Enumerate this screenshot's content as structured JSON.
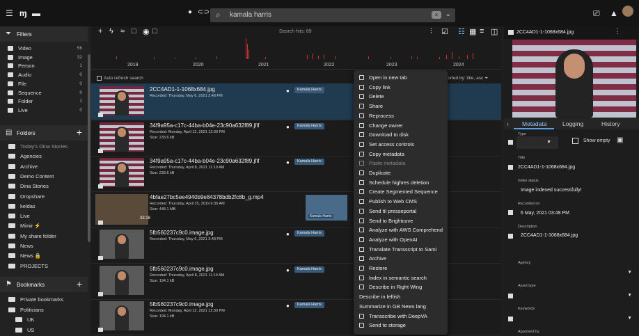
{
  "topbar": {
    "menu_icon": "menu-icon",
    "search_value": "kamala harris",
    "search_icon": "search-icon"
  },
  "sidebar": {
    "filters_title": "Filters",
    "filters": [
      {
        "label": "Video",
        "count": "56"
      },
      {
        "label": "Image",
        "count": "32"
      },
      {
        "label": "Person",
        "count": "1"
      },
      {
        "label": "Audio",
        "count": "0"
      },
      {
        "label": "File",
        "count": "0"
      },
      {
        "label": "Sequence",
        "count": "0"
      },
      {
        "label": "Folder",
        "count": "2"
      },
      {
        "label": "Live",
        "count": "0"
      }
    ],
    "folders_title": "Folders",
    "folders": [
      "Today's Dina Stories",
      "Agencies",
      "Archive",
      "Demo Content",
      "Dina Stories",
      "Dropshare",
      "keldas",
      "Live",
      "Mimir ⚡",
      "My share folder",
      "News",
      "News 🔒",
      "PROJECTS"
    ],
    "bookmarks_title": "Bookmarks",
    "bookmarks": [
      "Private bookmarks",
      "Politicians",
      "UK",
      "US"
    ]
  },
  "main": {
    "search_hits": "Search hits: 89",
    "years": [
      "2019",
      "2020",
      "2021",
      "2022",
      "2023",
      "2024"
    ],
    "auto_refresh": "Auto refresh search",
    "sorted_by": "Sorted by: title, asc",
    "da_label": "Da",
    "results": [
      {
        "name": "2CC4AD1-1-1068x684.jpg",
        "meta": [
          "Recorded: Thursday, May 6, 2021 3:48 PM"
        ],
        "badge": "Kamala Harris"
      },
      {
        "name": "34f9a95a-c17c-44ba-b04e-23c90a632f89.jfif",
        "meta": [
          "Recorded: Monday, April 12, 2021 12:30 PM",
          "Size: 233.6 kB"
        ],
        "badge": "Kamala Harris"
      },
      {
        "name": "34f9a95a-c17c-44ba-b04e-23c90a632f89.jfif",
        "meta": [
          "Recorded: Thursday, April 8, 2021 11:19 AM",
          "Size: 233.6 kB"
        ],
        "badge": "Kamala Harris"
      },
      {
        "name": "4bfae27bc5ee4940b9e84378bdb2fc8b_g.mp4",
        "meta": [
          "Recorded: Thursday, April 25, 2019 6:36 AM",
          "Size: 448.1 MB"
        ],
        "badge": "Kamala Harris",
        "duration": "33:18"
      },
      {
        "name": "5fb560237c9c0.image.jpg",
        "meta": [
          "Recorded: Thursday, May 6, 2021 3:48 PM"
        ],
        "badge": "Kamala Harris"
      },
      {
        "name": "5fb560237c9c0.image.jpg",
        "meta": [
          "Recorded: Thursday, April 8, 2021 11:19 AM",
          "Size: 194.1 kB"
        ],
        "badge": "Kamala Harris"
      },
      {
        "name": "5fb560237c9c0.image.jpg",
        "meta": [
          "Recorded: Monday, April 12, 2021 12:30 PM",
          "Size: 194.1 kB"
        ],
        "badge": "Kamala Harris"
      }
    ]
  },
  "context_menu": [
    {
      "label": "Open in new tab"
    },
    {
      "label": "Copy link"
    },
    {
      "label": "Delete"
    },
    {
      "label": "Share"
    },
    {
      "label": "Reprocess"
    },
    {
      "label": "Change owner"
    },
    {
      "label": "Download to disk"
    },
    {
      "label": "Set access controls"
    },
    {
      "label": "Copy metadata"
    },
    {
      "label": "Paste metadata",
      "disabled": true
    },
    {
      "label": "Duplicate"
    },
    {
      "label": "Schedule highres deletion"
    },
    {
      "label": "Create Segmented Sequence"
    },
    {
      "label": "Publish to Web CMS"
    },
    {
      "label": "Send til presseportal"
    },
    {
      "label": "Send to Brightcove"
    },
    {
      "label": "Analyze with AWS Comprehend"
    },
    {
      "label": "Analyze with OpenAI"
    },
    {
      "label": "Translate Transscript to Sami"
    },
    {
      "label": "Archive"
    },
    {
      "label": "Restore"
    },
    {
      "label": "Index in semantic search"
    },
    {
      "label": "Describe in Right Wing"
    },
    {
      "label": "Describe in leftish",
      "noicon": true
    },
    {
      "label": "Summarize in GB News lang",
      "noicon": true
    },
    {
      "label": "Transscribe with DeepVA"
    },
    {
      "label": "Send to storage"
    }
  ],
  "right_panel": {
    "filename": "2CC4AD1-1-1068x684.jpg",
    "tabs": [
      "Metadata",
      "Logging",
      "History"
    ],
    "type_label": "Type",
    "show_empty": "Show empty",
    "title_label": "Title",
    "title_value": "2CC4AD1-1-1068x684.jpg",
    "index_status_label": "Index status",
    "index_status_value": "Image indexed successfully!",
    "recorded_label": "Recorded on",
    "recorded_value": "6 May, 2021 03:48 PM",
    "description_label": "Description",
    "description_value": "2CC4AD1-1-1068x684.jpg",
    "agency_label": "Agency",
    "asset_type_label": "Asset type",
    "keywords_label": "Keywords",
    "approved_label": "Approved by"
  }
}
